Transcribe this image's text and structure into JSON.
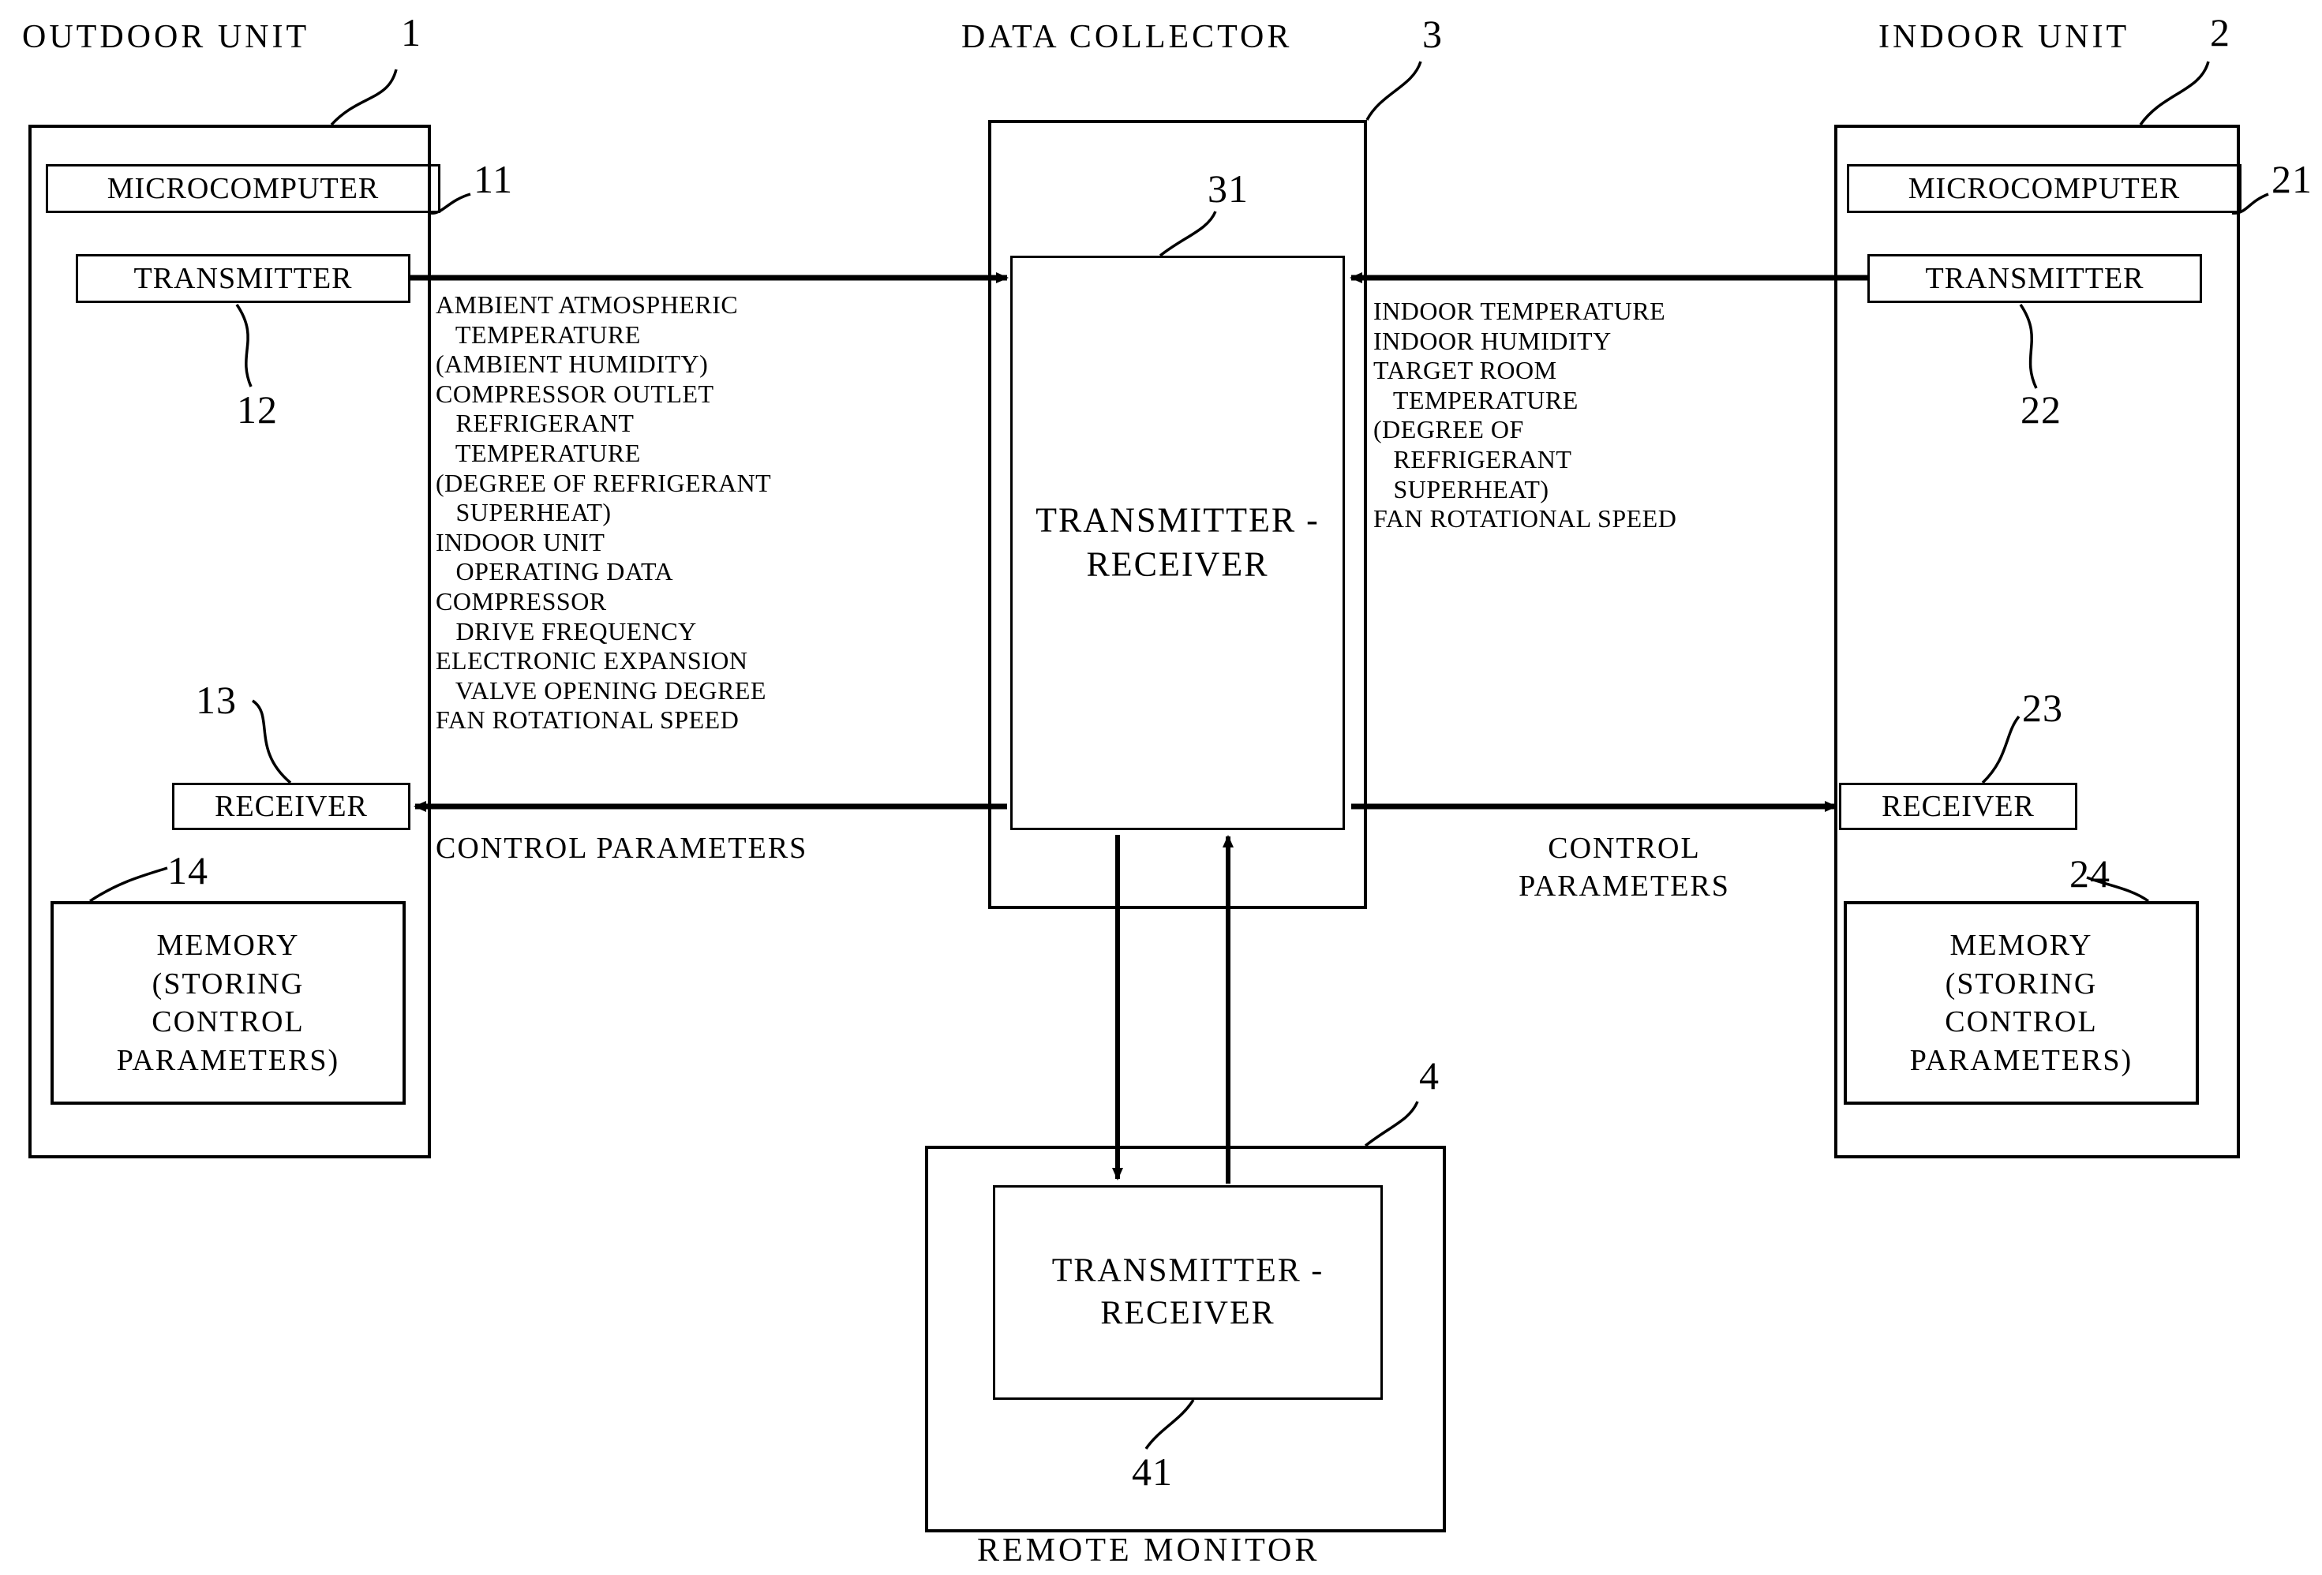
{
  "figure": {
    "type": "patent-block-diagram",
    "description": "Air conditioner data collection system block diagram"
  },
  "outdoor_unit": {
    "title": "OUTDOOR UNIT",
    "ref": "1",
    "microcomputer": {
      "label": "MICROCOMPUTER",
      "ref": "11"
    },
    "transmitter": {
      "label": "TRANSMITTER",
      "ref": "12"
    },
    "receiver": {
      "label": "RECEIVER",
      "ref": "13"
    },
    "memory": {
      "label": "MEMORY\n(STORING\nCONTROL\nPARAMETERS)",
      "ref": "14"
    }
  },
  "indoor_unit": {
    "title": "INDOOR UNIT",
    "ref": "2",
    "microcomputer": {
      "label": "MICROCOMPUTER",
      "ref": "21"
    },
    "transmitter": {
      "label": "TRANSMITTER",
      "ref": "22"
    },
    "receiver": {
      "label": "RECEIVER",
      "ref": "23"
    },
    "memory": {
      "label": "MEMORY\n(STORING\nCONTROL\nPARAMETERS)",
      "ref": "24"
    }
  },
  "data_collector": {
    "title": "DATA COLLECTOR",
    "ref": "3",
    "transceiver": {
      "label": "TRANSMITTER -\nRECEIVER",
      "ref": "31"
    }
  },
  "remote_monitor": {
    "title": "REMOTE MONITOR",
    "ref": "4",
    "transceiver": {
      "label": "TRANSMITTER -\nRECEIVER",
      "ref": "41"
    }
  },
  "signals": {
    "outdoor_to_collector": "AMBIENT ATMOSPHERIC\n   TEMPERATURE\n(AMBIENT HUMIDITY)\nCOMPRESSOR OUTLET\n   REFRIGERANT\n   TEMPERATURE\n(DEGREE OF REFRIGERANT\n   SUPERHEAT)\nINDOOR UNIT\n   OPERATING DATA\nCOMPRESSOR\n   DRIVE FREQUENCY\nELECTRONIC EXPANSION\n   VALVE OPENING DEGREE\nFAN ROTATIONAL SPEED",
    "collector_to_indoor": "INDOOR TEMPERATURE\nINDOOR HUMIDITY\nTARGET ROOM\n   TEMPERATURE\n(DEGREE OF\n   REFRIGERANT\n   SUPERHEAT)\nFAN ROTATIONAL SPEED",
    "control_parameters_left": "CONTROL PARAMETERS",
    "control_parameters_right": "CONTROL\nPARAMETERS"
  }
}
